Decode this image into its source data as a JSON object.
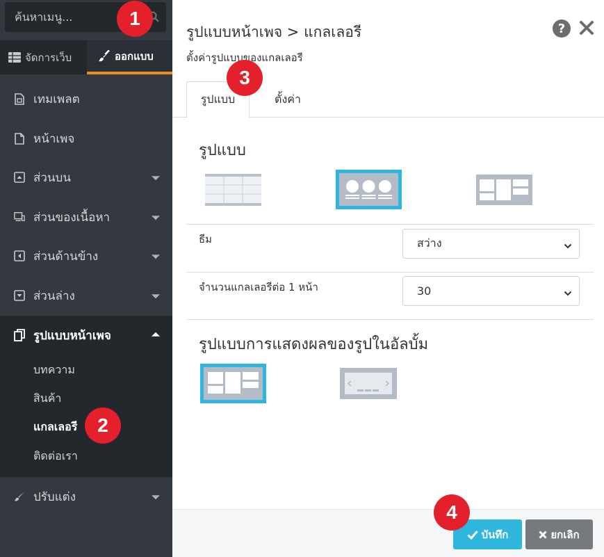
{
  "sidebar": {
    "search": {
      "placeholder": "ค้นหาเมนู..."
    },
    "tabs": [
      {
        "label": "จัดการเว็บ",
        "icon": "table-icon"
      },
      {
        "label": "ออกแบบ",
        "icon": "brush-icon"
      }
    ],
    "menu": [
      {
        "label": "เทมเพลต",
        "icon": "template-icon"
      },
      {
        "label": "หน้าเพจ",
        "icon": "file-icon"
      },
      {
        "label": "ส่วนบน",
        "icon": "arrow-up-box-icon"
      },
      {
        "label": "ส่วนของเนื้อหา",
        "icon": "content-icon"
      },
      {
        "label": "ส่วนด้านข้าง",
        "icon": "arrow-left-box-icon"
      },
      {
        "label": "ส่วนล่าง",
        "icon": "arrow-down-box-icon"
      },
      {
        "label": "รูปแบบหน้าเพจ",
        "icon": "copy-icon"
      },
      {
        "label": "ปรับแต่ง",
        "icon": "brush-icon"
      }
    ],
    "submenu": [
      "บทความ",
      "สินค้า",
      "แกลเลอรี",
      "ติดต่อเรา"
    ],
    "active_submenu": "แกลเลอรี"
  },
  "dialog": {
    "title": "รูปแบบหน้าเพจ > แกลเลอรี",
    "subtitle": "ตั้งค่ารูปแบบของแกลเลอรี",
    "tabs": [
      "รูปแบบ",
      "ตั้งค่า"
    ],
    "section_layout": "รูปแบบ",
    "theme_label": "ธีม",
    "theme_value": "สว่าง",
    "per_page_label": "จำนวนแกลเลอรีต่อ 1 หน้า",
    "per_page_value": "30",
    "section_album": "รูปแบบการแสดงผลของรูปในอัลบั้ม",
    "save_label": "บันทึก",
    "cancel_label": "ยกเลิก"
  },
  "callouts": [
    "1",
    "2",
    "3",
    "4"
  ],
  "colors": {
    "sidebar_bg": "#33393f",
    "sidebar_dark": "#23282d",
    "accent_orange": "#f08a24",
    "selected_blue": "#2fb6de",
    "callout_red": "#e3202b",
    "cancel_gray": "#777a7d"
  }
}
